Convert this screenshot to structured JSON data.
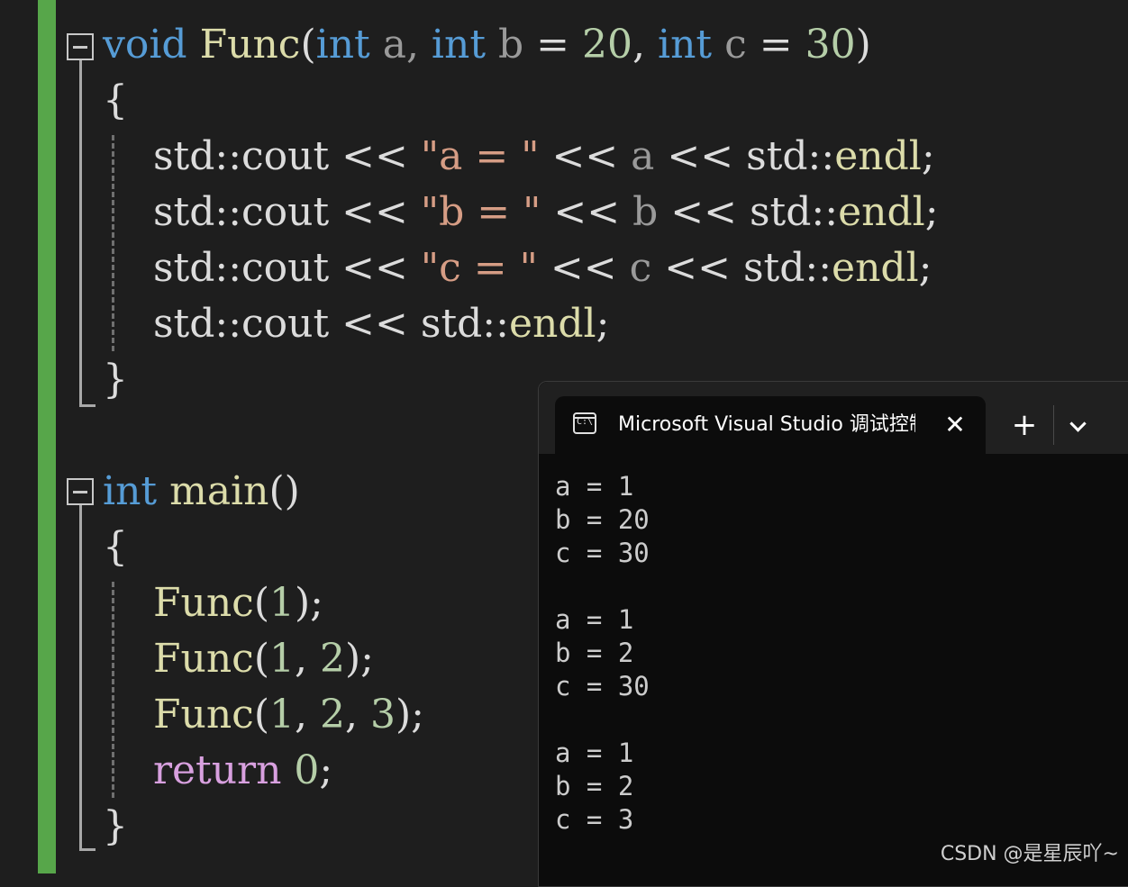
{
  "editor": {
    "lines": [
      {
        "tokens": [
          {
            "t": "void",
            "c": "kw"
          },
          {
            "t": " ",
            "c": "plain"
          },
          {
            "t": "Func",
            "c": "fn"
          },
          {
            "t": "(",
            "c": "plain"
          },
          {
            "t": "int",
            "c": "kw"
          },
          {
            "t": " a, ",
            "c": "param"
          },
          {
            "t": "int",
            "c": "kw"
          },
          {
            "t": " b ",
            "c": "param"
          },
          {
            "t": "= ",
            "c": "plain"
          },
          {
            "t": "20",
            "c": "num"
          },
          {
            "t": ", ",
            "c": "plain"
          },
          {
            "t": "int",
            "c": "kw"
          },
          {
            "t": " c ",
            "c": "param"
          },
          {
            "t": "= ",
            "c": "plain"
          },
          {
            "t": "30",
            "c": "num"
          },
          {
            "t": ")",
            "c": "plain"
          }
        ]
      },
      {
        "tokens": [
          {
            "t": "{",
            "c": "plain"
          }
        ]
      },
      {
        "tokens": [
          {
            "t": "    std::cout << ",
            "c": "plain"
          },
          {
            "t": "\"a = \"",
            "c": "str"
          },
          {
            "t": " << ",
            "c": "plain"
          },
          {
            "t": "a",
            "c": "param"
          },
          {
            "t": " << std::",
            "c": "plain"
          },
          {
            "t": "endl",
            "c": "fn"
          },
          {
            "t": ";",
            "c": "plain"
          }
        ]
      },
      {
        "tokens": [
          {
            "t": "    std::cout << ",
            "c": "plain"
          },
          {
            "t": "\"b = \"",
            "c": "str"
          },
          {
            "t": " << ",
            "c": "plain"
          },
          {
            "t": "b",
            "c": "param"
          },
          {
            "t": " << std::",
            "c": "plain"
          },
          {
            "t": "endl",
            "c": "fn"
          },
          {
            "t": ";",
            "c": "plain"
          }
        ]
      },
      {
        "tokens": [
          {
            "t": "    std::cout << ",
            "c": "plain"
          },
          {
            "t": "\"c = \"",
            "c": "str"
          },
          {
            "t": " << ",
            "c": "plain"
          },
          {
            "t": "c",
            "c": "param"
          },
          {
            "t": " << std::",
            "c": "plain"
          },
          {
            "t": "endl",
            "c": "fn"
          },
          {
            "t": ";",
            "c": "plain"
          }
        ]
      },
      {
        "tokens": [
          {
            "t": "    std::cout << std::",
            "c": "plain"
          },
          {
            "t": "endl",
            "c": "fn"
          },
          {
            "t": ";",
            "c": "plain"
          }
        ]
      },
      {
        "tokens": [
          {
            "t": "}",
            "c": "plain"
          }
        ]
      },
      {
        "tokens": []
      },
      {
        "tokens": [
          {
            "t": "int",
            "c": "kw"
          },
          {
            "t": " ",
            "c": "plain"
          },
          {
            "t": "main",
            "c": "fn"
          },
          {
            "t": "()",
            "c": "plain"
          }
        ]
      },
      {
        "tokens": [
          {
            "t": "{",
            "c": "plain"
          }
        ]
      },
      {
        "tokens": [
          {
            "t": "    ",
            "c": "plain"
          },
          {
            "t": "Func",
            "c": "fn"
          },
          {
            "t": "(",
            "c": "plain"
          },
          {
            "t": "1",
            "c": "num"
          },
          {
            "t": ");",
            "c": "plain"
          }
        ]
      },
      {
        "tokens": [
          {
            "t": "    ",
            "c": "plain"
          },
          {
            "t": "Func",
            "c": "fn"
          },
          {
            "t": "(",
            "c": "plain"
          },
          {
            "t": "1",
            "c": "num"
          },
          {
            "t": ", ",
            "c": "plain"
          },
          {
            "t": "2",
            "c": "num"
          },
          {
            "t": ");",
            "c": "plain"
          }
        ]
      },
      {
        "tokens": [
          {
            "t": "    ",
            "c": "plain"
          },
          {
            "t": "Func",
            "c": "fn"
          },
          {
            "t": "(",
            "c": "plain"
          },
          {
            "t": "1",
            "c": "num"
          },
          {
            "t": ", ",
            "c": "plain"
          },
          {
            "t": "2",
            "c": "num"
          },
          {
            "t": ", ",
            "c": "plain"
          },
          {
            "t": "3",
            "c": "num"
          },
          {
            "t": ");",
            "c": "plain"
          }
        ]
      },
      {
        "tokens": [
          {
            "t": "    ",
            "c": "plain"
          },
          {
            "t": "return",
            "c": "kw-ctrl"
          },
          {
            "t": " ",
            "c": "plain"
          },
          {
            "t": "0",
            "c": "num"
          },
          {
            "t": ";",
            "c": "plain"
          }
        ]
      },
      {
        "tokens": [
          {
            "t": "}",
            "c": "plain"
          }
        ]
      }
    ],
    "colors": {
      "keyword": "#569cd6",
      "control": "#d8a0df",
      "function": "#dcdcaa",
      "number": "#b5cea8",
      "string": "#d69d85",
      "parameter": "#9a9a9a",
      "changeBar": "#57a64a"
    }
  },
  "terminal": {
    "tab_title": "Microsoft Visual Studio 调试控制台",
    "tab_icon": "console-icon",
    "close_icon": "close-icon",
    "new_tab_icon": "plus-icon",
    "dropdown_icon": "chevron-down-icon",
    "output": [
      "a = 1",
      "b = 20",
      "c = 30",
      "",
      "a = 1",
      "b = 2",
      "c = 30",
      "",
      "a = 1",
      "b = 2",
      "c = 3"
    ]
  },
  "watermark": "CSDN @是星辰吖~"
}
